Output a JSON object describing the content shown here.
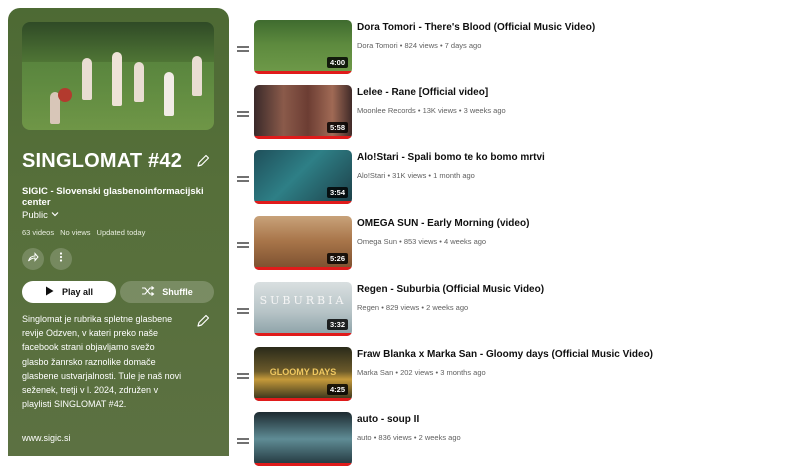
{
  "playlist": {
    "title": "SINGLOMAT #42",
    "owner": "SIGIC - Slovenski glasbenoinformacijski center",
    "privacy": "Public",
    "video_count": "63 videos",
    "views": "No views",
    "updated": "Updated today",
    "play_all_label": "Play all",
    "shuffle_label": "Shuffle",
    "description": "Singlomat je rubrika spletne glasbene revije Odzven, v kateri preko naše facebook strani objavljamo svežo glasbo žanrsko raznolike domače glasbene ustvarjalnosti. Tule je naš novi seženek, tretji v l. 2024, združen v playlisti SINGLOMAT #42.",
    "link": "www.sigic.si",
    "panel_color": "#566f3a"
  },
  "icons": {
    "edit": "pencil-icon",
    "share": "share-icon",
    "more": "more-vert-icon",
    "play": "play-icon",
    "shuffle": "shuffle-icon",
    "chevron": "chevron-down-icon",
    "drag": "drag-handle-icon"
  },
  "videos": [
    {
      "title": "Dora Tomori - There's Blood (Official Music Video)",
      "channel": "Dora Tomori",
      "views": "824 views",
      "age": "7 days ago",
      "duration": "4:00"
    },
    {
      "title": "Lelee - Rane [Official video]",
      "channel": "Moonlee Records",
      "views": "13K views",
      "age": "3 weeks ago",
      "duration": "5:58"
    },
    {
      "title": "Alo!Stari - Spali bomo te ko bomo mrtvi",
      "channel": "Alo!Stari",
      "views": "31K views",
      "age": "1 month ago",
      "duration": "3:54"
    },
    {
      "title": "OMEGA SUN - Early Morning (video)",
      "channel": "Omega Sun",
      "views": "853 views",
      "age": "4 weeks ago",
      "duration": "5:26"
    },
    {
      "title": "Regen - Suburbia (Official Music Video)",
      "channel": "Regen",
      "views": "829 views",
      "age": "2 weeks ago",
      "duration": "3:32",
      "thumb_text": "SUBURBIA"
    },
    {
      "title": "Fraw Blanka x Marka San - Gloomy days (Official Music Video)",
      "channel": "Marka San",
      "views": "202 views",
      "age": "3 months ago",
      "duration": "4:25",
      "thumb_text": "GLOOMY DAYS"
    },
    {
      "title": "auto - soup II",
      "channel": "auto",
      "views": "836 views",
      "age": "2 weeks ago",
      "duration": ""
    }
  ]
}
